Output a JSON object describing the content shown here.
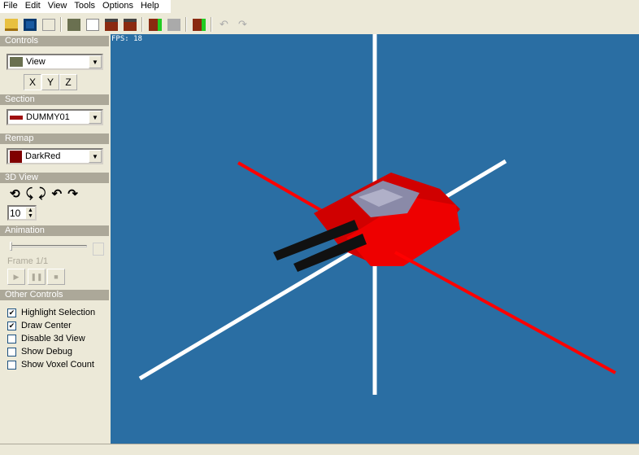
{
  "menu": [
    "File",
    "Edit",
    "View",
    "Tools",
    "Options",
    "Help"
  ],
  "toolbar": [
    "open-icon",
    "save-icon",
    "export-icon",
    "view-icon",
    "paint-icon",
    "section-a-icon",
    "section-b-icon",
    "add-section-icon",
    "disabled-icon",
    "add-frame-icon",
    "undo-icon",
    "redo-icon"
  ],
  "controls": {
    "header": "Controls",
    "mode": "View",
    "axes": [
      "X",
      "Y",
      "Z"
    ]
  },
  "section": {
    "header": "Section",
    "value": "DUMMY01"
  },
  "remap": {
    "header": "Remap",
    "value": "DarkRed",
    "color": "#800000"
  },
  "view3d": {
    "header": "3D View",
    "step": "10"
  },
  "animation": {
    "header": "Animation",
    "frame": "Frame 1/1"
  },
  "other": {
    "header": "Other Controls",
    "items": [
      {
        "label": "Highlight Selection",
        "checked": true
      },
      {
        "label": "Draw Center",
        "checked": true
      },
      {
        "label": "Disable 3d View",
        "checked": false
      },
      {
        "label": "Show Debug",
        "checked": false
      },
      {
        "label": "Show Voxel Count",
        "checked": false
      }
    ]
  },
  "viewport": {
    "fps": "FPS: 18",
    "background": "#2a6ea3"
  }
}
